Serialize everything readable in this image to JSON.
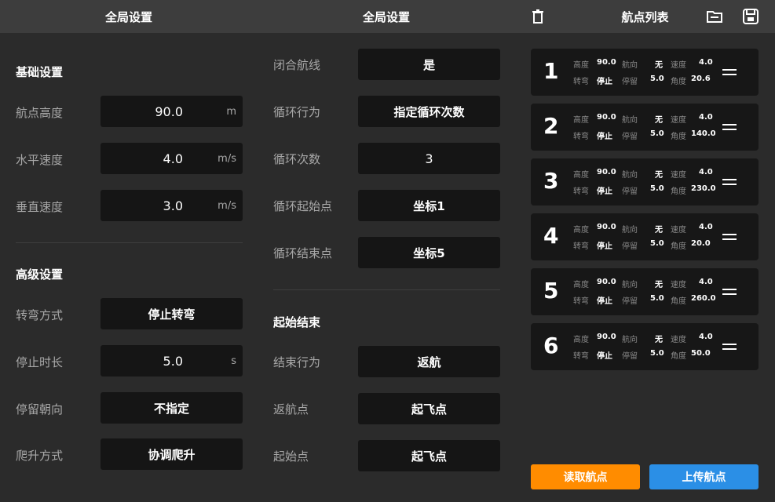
{
  "left": {
    "header": "全局设置",
    "basic_title": "基础设置",
    "rows": [
      {
        "label": "航点高度",
        "value": "90.0",
        "unit": "m"
      },
      {
        "label": "水平速度",
        "value": "4.0",
        "unit": "m/s"
      },
      {
        "label": "垂直速度",
        "value": "3.0",
        "unit": "m/s"
      }
    ],
    "advanced_title": "高级设置",
    "adv_rows": [
      {
        "label": "转弯方式",
        "value": "停止转弯"
      },
      {
        "label": "停止时长",
        "value": "5.0",
        "unit": "s"
      },
      {
        "label": "停留朝向",
        "value": "不指定"
      },
      {
        "label": "爬升方式",
        "value": "协调爬升"
      }
    ]
  },
  "mid": {
    "header": "全局设置",
    "rows": [
      {
        "label": "闭合航线",
        "value": "是"
      },
      {
        "label": "循环行为",
        "value": "指定循环次数"
      },
      {
        "label": "循环次数",
        "value": "3"
      },
      {
        "label": "循环起始点",
        "value": "坐标1"
      },
      {
        "label": "循环结束点",
        "value": "坐标5"
      }
    ],
    "end_title": "起始结束",
    "end_rows": [
      {
        "label": "结束行为",
        "value": "返航"
      },
      {
        "label": "返航点",
        "value": "起飞点"
      },
      {
        "label": "起始点",
        "value": "起飞点"
      }
    ]
  },
  "right": {
    "header": "航点列表",
    "icons": {
      "delete": "trash-icon",
      "open": "folder-icon",
      "save": "save-icon"
    },
    "keys": {
      "height": "高度",
      "heading": "航向",
      "speed": "速度",
      "turn": "转弯",
      "stay": "停留",
      "angle": "角度"
    },
    "waypoints": [
      {
        "num": "1",
        "height": "90.0",
        "heading": "无",
        "speed": "4.0",
        "turn": "停止",
        "stay": "5.0",
        "angle": "20.6"
      },
      {
        "num": "2",
        "height": "90.0",
        "heading": "无",
        "speed": "4.0",
        "turn": "停止",
        "stay": "5.0",
        "angle": "140.0"
      },
      {
        "num": "3",
        "height": "90.0",
        "heading": "无",
        "speed": "4.0",
        "turn": "停止",
        "stay": "5.0",
        "angle": "230.0"
      },
      {
        "num": "4",
        "height": "90.0",
        "heading": "无",
        "speed": "4.0",
        "turn": "停止",
        "stay": "5.0",
        "angle": "20.0"
      },
      {
        "num": "5",
        "height": "90.0",
        "heading": "无",
        "speed": "4.0",
        "turn": "停止",
        "stay": "5.0",
        "angle": "260.0"
      },
      {
        "num": "6",
        "height": "90.0",
        "heading": "无",
        "speed": "4.0",
        "turn": "停止",
        "stay": "5.0",
        "angle": "50.0"
      }
    ],
    "read_label": "读取航点",
    "upload_label": "上传航点"
  },
  "colors": {
    "read_button": "#ff8c00",
    "upload_button": "#2b8fe6"
  }
}
